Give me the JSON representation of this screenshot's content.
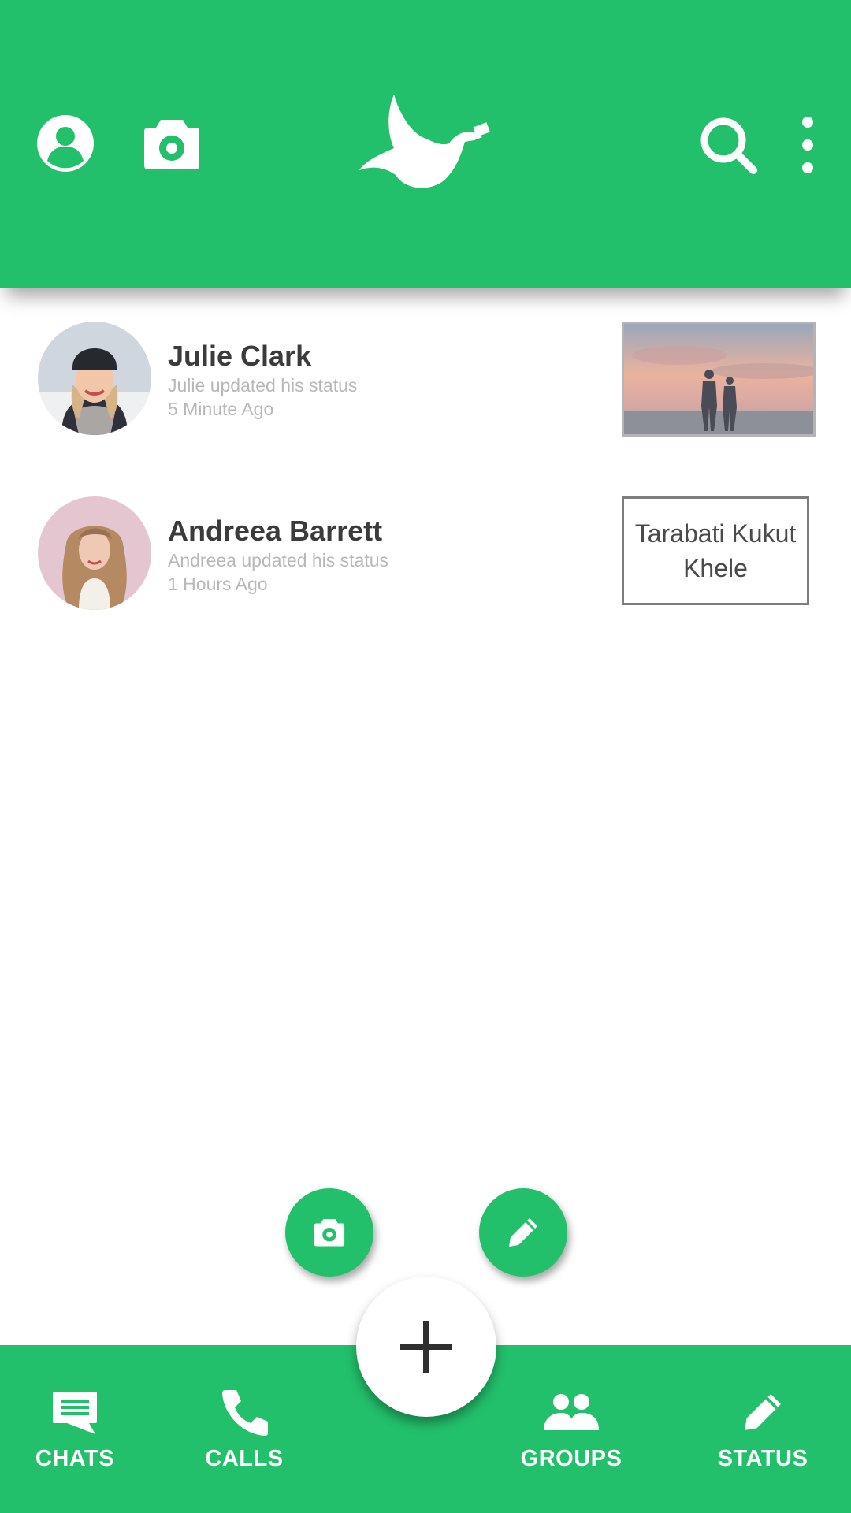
{
  "colors": {
    "primary": "#22c06b",
    "white": "#ffffff",
    "name_text": "#3b3b3b",
    "sub_text": "#b8b8b8"
  },
  "header": {
    "icons": [
      "profile-icon",
      "camera-icon",
      "dove-logo",
      "search-icon",
      "more-vertical-icon"
    ]
  },
  "statuses": [
    {
      "name": "Julie Clark",
      "message": "Julie updated his status",
      "time": "5 Minute Ago",
      "preview_type": "image"
    },
    {
      "name": "Andreea Barrett",
      "message": "Andreea updated his status",
      "time": "1 Hours Ago",
      "preview_type": "text",
      "preview_text": "Tarabati Kukut Khele"
    }
  ],
  "fabs": {
    "small": [
      "camera-icon",
      "pencil-icon"
    ],
    "main": "plus-icon"
  },
  "nav": [
    {
      "label": "CHATS",
      "icon": "chat-icon"
    },
    {
      "label": "CALLS",
      "icon": "phone-icon"
    },
    {
      "label": "GROUPS",
      "icon": "groups-icon"
    },
    {
      "label": "STATUS",
      "icon": "pencil-icon"
    }
  ]
}
